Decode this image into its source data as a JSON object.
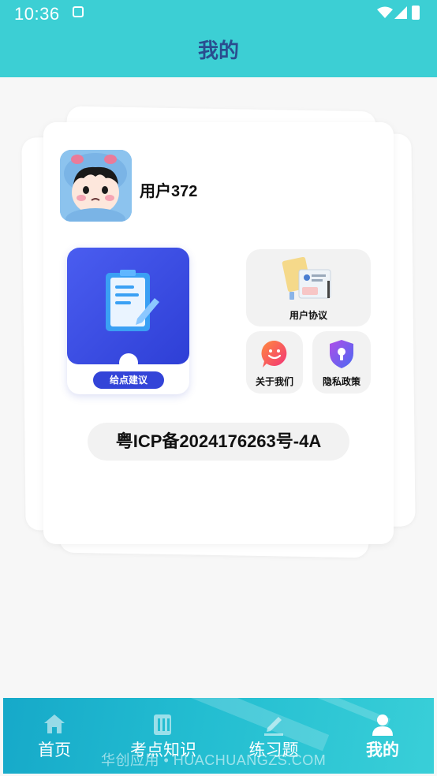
{
  "status_bar": {
    "time": "10:36"
  },
  "header": {
    "title": "我的"
  },
  "profile": {
    "username": "用户372"
  },
  "actions": {
    "feedback_label": "给点建议",
    "user_agreement_label": "用户协议",
    "about_us_label": "关于我们",
    "privacy_policy_label": "隐私政策"
  },
  "icp": {
    "text": "粤ICP备2024176263号-4A"
  },
  "tabbar": {
    "items": [
      {
        "label": "首页",
        "icon": "home-icon",
        "active": false
      },
      {
        "label": "考点知识",
        "icon": "notebook-icon",
        "active": false
      },
      {
        "label": "练习题",
        "icon": "pen-icon",
        "active": false
      },
      {
        "label": "我的",
        "icon": "user-icon",
        "active": true
      }
    ],
    "watermark": "华创应用 • HUACHUANGZS.COM"
  },
  "colors": {
    "header": "#3ccfd4",
    "title": "#2a4d8f",
    "feedback_blue": "#3344d8"
  }
}
